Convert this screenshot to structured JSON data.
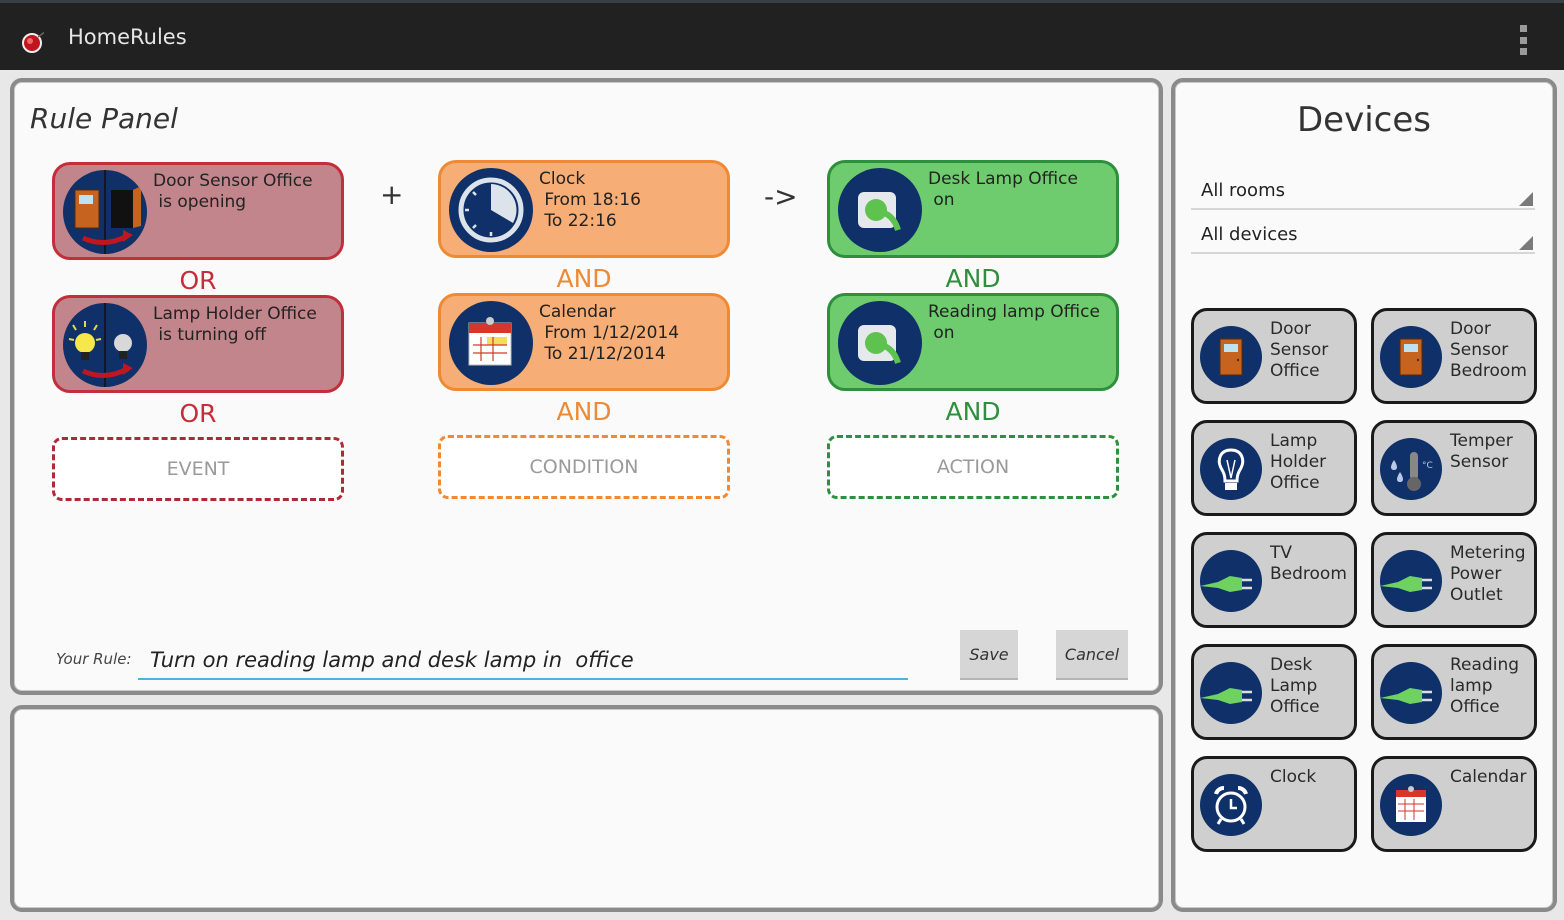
{
  "app": {
    "title": "HomeRules",
    "logo_icon": "app-logo-icon",
    "menu_icon": "overflow-menu-icon"
  },
  "rule_panel": {
    "title": "Rule Panel",
    "joiners": {
      "plus": "+",
      "arrow": "->"
    },
    "events": [
      {
        "icon": "door-opening-icon",
        "text": "Door Sensor Office\n is opening"
      },
      {
        "icon": "lamp-turning-off-icon",
        "text": "Lamp Holder Office\n is turning off"
      }
    ],
    "event_operator": "OR",
    "event_slot": "EVENT",
    "conditions": [
      {
        "icon": "clock-icon",
        "text": "Clock\n From 18:16\n To 22:16"
      },
      {
        "icon": "calendar-icon",
        "text": "Calendar\n From 1/12/2014\n To 21/12/2014"
      }
    ],
    "condition_operator": "AND",
    "condition_slot": "CONDITION",
    "actions": [
      {
        "icon": "plug-socket-icon",
        "text": "Desk Lamp Office\n on"
      },
      {
        "icon": "plug-socket-icon",
        "text": "Reading lamp Office\n on"
      }
    ],
    "action_operator": "AND",
    "action_slot": "ACTION",
    "rule_label": "Your Rule:",
    "rule_value": "Turn on reading lamp and desk lamp in  office",
    "save_label": "Save",
    "cancel_label": "Cancel"
  },
  "devices_panel": {
    "title": "Devices",
    "rooms_filter": "All rooms",
    "devices_filter": "All devices",
    "devices": [
      {
        "icon": "door-icon",
        "label": "Door\nSensor\nOffice"
      },
      {
        "icon": "door-icon",
        "label": "Door\nSensor\nBedroom"
      },
      {
        "icon": "lightbulb-icon",
        "label": "Lamp\nHolder\nOffice"
      },
      {
        "icon": "temperature-humidity-icon",
        "label": "Temper\nSensor"
      },
      {
        "icon": "plug-icon",
        "label": "TV\nBedroom"
      },
      {
        "icon": "plug-icon",
        "label": "Metering\nPower\nOutlet"
      },
      {
        "icon": "plug-icon",
        "label": "Desk\nLamp\nOffice"
      },
      {
        "icon": "plug-icon",
        "label": "Reading\nlamp\nOffice"
      },
      {
        "icon": "alarm-clock-icon",
        "label": "Clock"
      },
      {
        "icon": "calendar-icon",
        "label": "Calendar"
      }
    ]
  },
  "colors": {
    "event": "#c22e3a",
    "condition": "#ee8a34",
    "action": "#2e8f3c",
    "icon_bg": "#0f3068",
    "appbar": "#212121",
    "input_underline": "#4fb3d6"
  }
}
